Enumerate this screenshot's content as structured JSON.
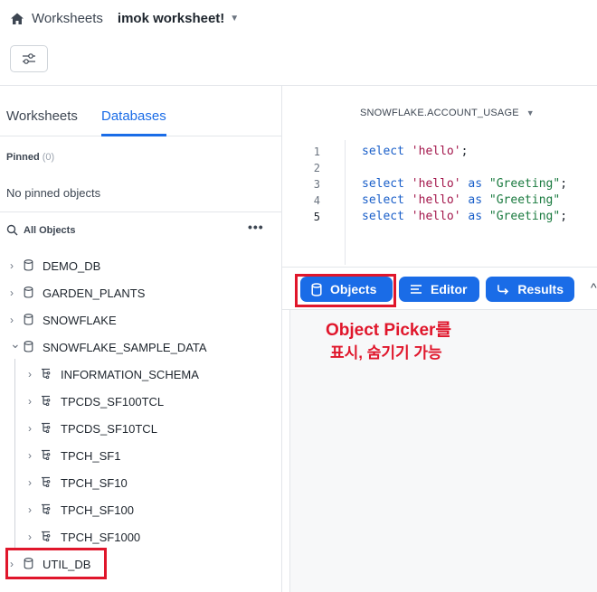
{
  "header": {
    "breadcrumb_root": "Worksheets",
    "worksheet_title": "imok worksheet!",
    "icons": {
      "home": "home-icon",
      "caret": "caret-down-icon",
      "filter": "sliders-icon"
    }
  },
  "left_panel": {
    "tabs": [
      {
        "label": "Worksheets",
        "active": false
      },
      {
        "label": "Databases",
        "active": true
      }
    ],
    "pinned_label": "Pinned",
    "pinned_count": "(0)",
    "no_pinned_text": "No pinned objects",
    "all_objects_label": "All Objects",
    "more_label": "•••",
    "tree": [
      {
        "label": "DEMO_DB",
        "level": 0,
        "expanded": false,
        "icon": "database-icon"
      },
      {
        "label": "GARDEN_PLANTS",
        "level": 0,
        "expanded": false,
        "icon": "database-icon"
      },
      {
        "label": "SNOWFLAKE",
        "level": 0,
        "expanded": false,
        "icon": "database-icon"
      },
      {
        "label": "SNOWFLAKE_SAMPLE_DATA",
        "level": 0,
        "expanded": true,
        "icon": "database-icon"
      },
      {
        "label": "INFORMATION_SCHEMA",
        "level": 1,
        "expanded": false,
        "icon": "schema-icon"
      },
      {
        "label": "TPCDS_SF100TCL",
        "level": 1,
        "expanded": false,
        "icon": "schema-icon"
      },
      {
        "label": "TPCDS_SF10TCL",
        "level": 1,
        "expanded": false,
        "icon": "schema-icon"
      },
      {
        "label": "TPCH_SF1",
        "level": 1,
        "expanded": false,
        "icon": "schema-icon"
      },
      {
        "label": "TPCH_SF10",
        "level": 1,
        "expanded": false,
        "icon": "schema-icon"
      },
      {
        "label": "TPCH_SF100",
        "level": 1,
        "expanded": false,
        "icon": "schema-icon"
      },
      {
        "label": "TPCH_SF1000",
        "level": 1,
        "expanded": false,
        "icon": "schema-icon"
      },
      {
        "label": "UTIL_DB",
        "level": 0,
        "expanded": false,
        "icon": "database-icon"
      }
    ]
  },
  "editor": {
    "context_label": "SNOWFLAKE.ACCOUNT_USAGE",
    "line_numbers": [
      "1",
      "2",
      "3",
      "4",
      "5"
    ],
    "active_line": "5"
  },
  "toolbar": {
    "objects_label": "Objects",
    "editor_label": "Editor",
    "results_label": "Results"
  },
  "annotation": {
    "line1": "Object Picker를",
    "line2": "표시, 숨기기 가능",
    "color": "#e0162b"
  },
  "colors": {
    "accent": "#1a6ce7",
    "highlight": "#e0162b"
  }
}
